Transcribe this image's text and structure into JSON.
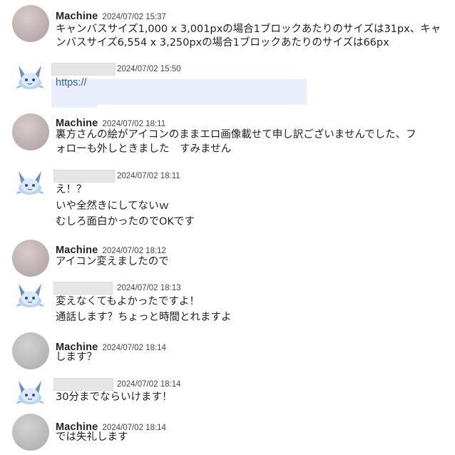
{
  "messages": [
    {
      "author": "Machine",
      "timestamp": "2024/07/02 15:37",
      "lines": [
        "キャンバスサイズ1,000 x 3,001pxの場合1ブロックあたりのサイズは31px、キャ",
        "ンバスサイズ6,554 x 3,250pxの場合1ブロックあたりのサイズは66px"
      ]
    },
    {
      "author": "",
      "timestamp": "2024/07/02 15:50",
      "link": "https://"
    },
    {
      "author": "Machine",
      "timestamp": "2024/07/02 18:11",
      "lines": [
        "裏方さんの絵がアイコンのままエロ画像載せて申し訳ございませんでした、フ",
        "ォローも外しときました　すみません"
      ]
    },
    {
      "author": "",
      "timestamp": "2024/07/02 18:11",
      "lines": [
        "え！？",
        "いや全然きにしてないｗ",
        "むしろ面白かったのでOKです"
      ]
    },
    {
      "author": "Machine",
      "timestamp": "2024/07/02 18:12",
      "lines": [
        "アイコン変えましたので"
      ]
    },
    {
      "author": "",
      "timestamp": "2024/07/02 18:13",
      "lines": [
        "変えなくてもよかったですよ！",
        "通話します？ちょっと時間とれますよ"
      ]
    },
    {
      "author": "Machine",
      "timestamp": "2024/07/02 18:14",
      "lines": [
        "します？"
      ]
    },
    {
      "author": "",
      "timestamp": "2024/07/02 18:14",
      "lines": [
        "30分までならいけます！"
      ]
    },
    {
      "author": "Machine",
      "timestamp": "2024/07/02 18:14",
      "lines": [
        "では失礼します"
      ]
    }
  ]
}
